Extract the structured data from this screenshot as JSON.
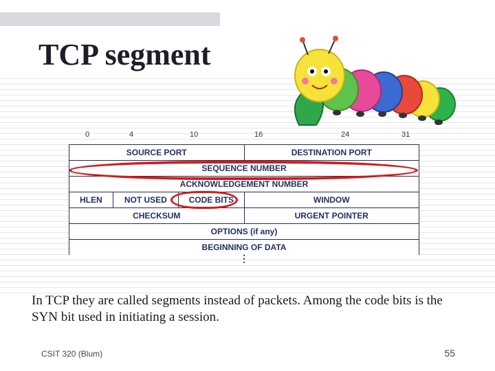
{
  "title": "TCP segment",
  "bits": {
    "b0": "0",
    "b4": "4",
    "b10": "10",
    "b16": "16",
    "b24": "24",
    "b31": "31"
  },
  "diagram": {
    "row1": {
      "src": "SOURCE PORT",
      "dst": "DESTINATION PORT"
    },
    "row2": "SEQUENCE NUMBER",
    "row3": "ACKNOWLEDGEMENT NUMBER",
    "row4": {
      "hlen": "HLEN",
      "notused": "NOT USED",
      "codebits": "CODE BITS",
      "window": "WINDOW"
    },
    "row5": {
      "checksum": "CHECKSUM",
      "urgent": "URGENT POINTER"
    },
    "row6": "OPTIONS (if any)",
    "row7": "BEGINNING OF DATA"
  },
  "body_text": "In TCP they are called segments instead of packets.  Among the code bits is the SYN bit used in initiating a session.",
  "footer": {
    "course": "CSIT 320 (Blum)",
    "page": "55"
  }
}
